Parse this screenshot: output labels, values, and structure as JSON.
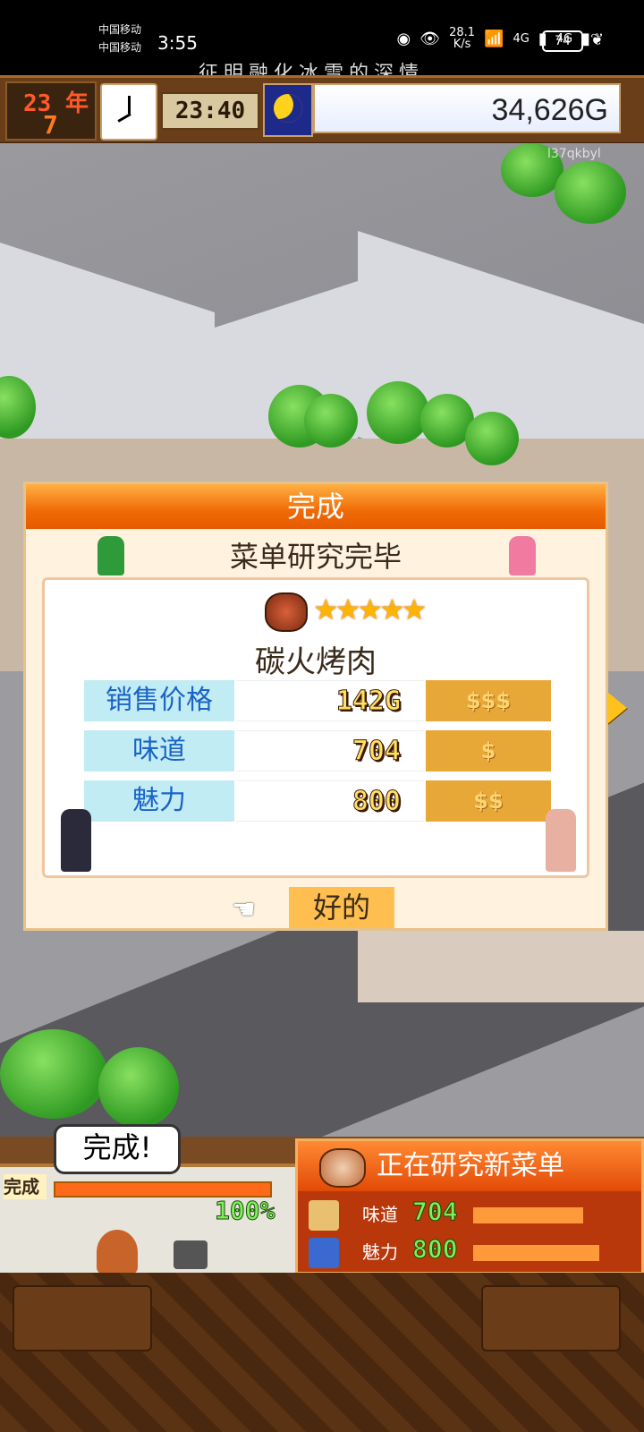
{
  "status_bar": {
    "carrier1": "中国移动",
    "carrier2": "中国移动",
    "time": "3:55",
    "net_speed_value": "28.1",
    "net_speed_unit": "K/s",
    "signal1": "4G",
    "signal2": "4G",
    "battery": "74",
    "lyric": "征明融化冰雪的深情"
  },
  "game_header": {
    "year": "23 年",
    "month": "7 月",
    "time": "23:40",
    "money": "34,626G"
  },
  "watermark": "l37qkbyl",
  "dialog": {
    "title": "完成",
    "subtitle": "菜单研究完毕",
    "dish_name": "碳火烤肉",
    "stars": "★★★★★",
    "stats": [
      {
        "label": "销售价格",
        "value": "142G",
        "rank": "$$$"
      },
      {
        "label": "味道",
        "value": "704",
        "rank": "$"
      },
      {
        "label": "魅力",
        "value": "800",
        "rank": "$$"
      }
    ],
    "ok_label": "好的"
  },
  "kitchen": {
    "label": "完成",
    "bubble": "完成!",
    "progress_pct": "100%",
    "progress_fraction": 1.0
  },
  "research_panel": {
    "title": "正在研究新菜单",
    "rows": [
      {
        "name": "味道",
        "value": "704",
        "fraction": 0.7
      },
      {
        "name": "魅力",
        "value": "800",
        "fraction": 0.8
      }
    ]
  },
  "colors": {
    "dialog_title": "#f06a06",
    "label_bg": "#c2ecf4",
    "rank_bg": "#e8a838",
    "research_bg": "#b8380c"
  }
}
